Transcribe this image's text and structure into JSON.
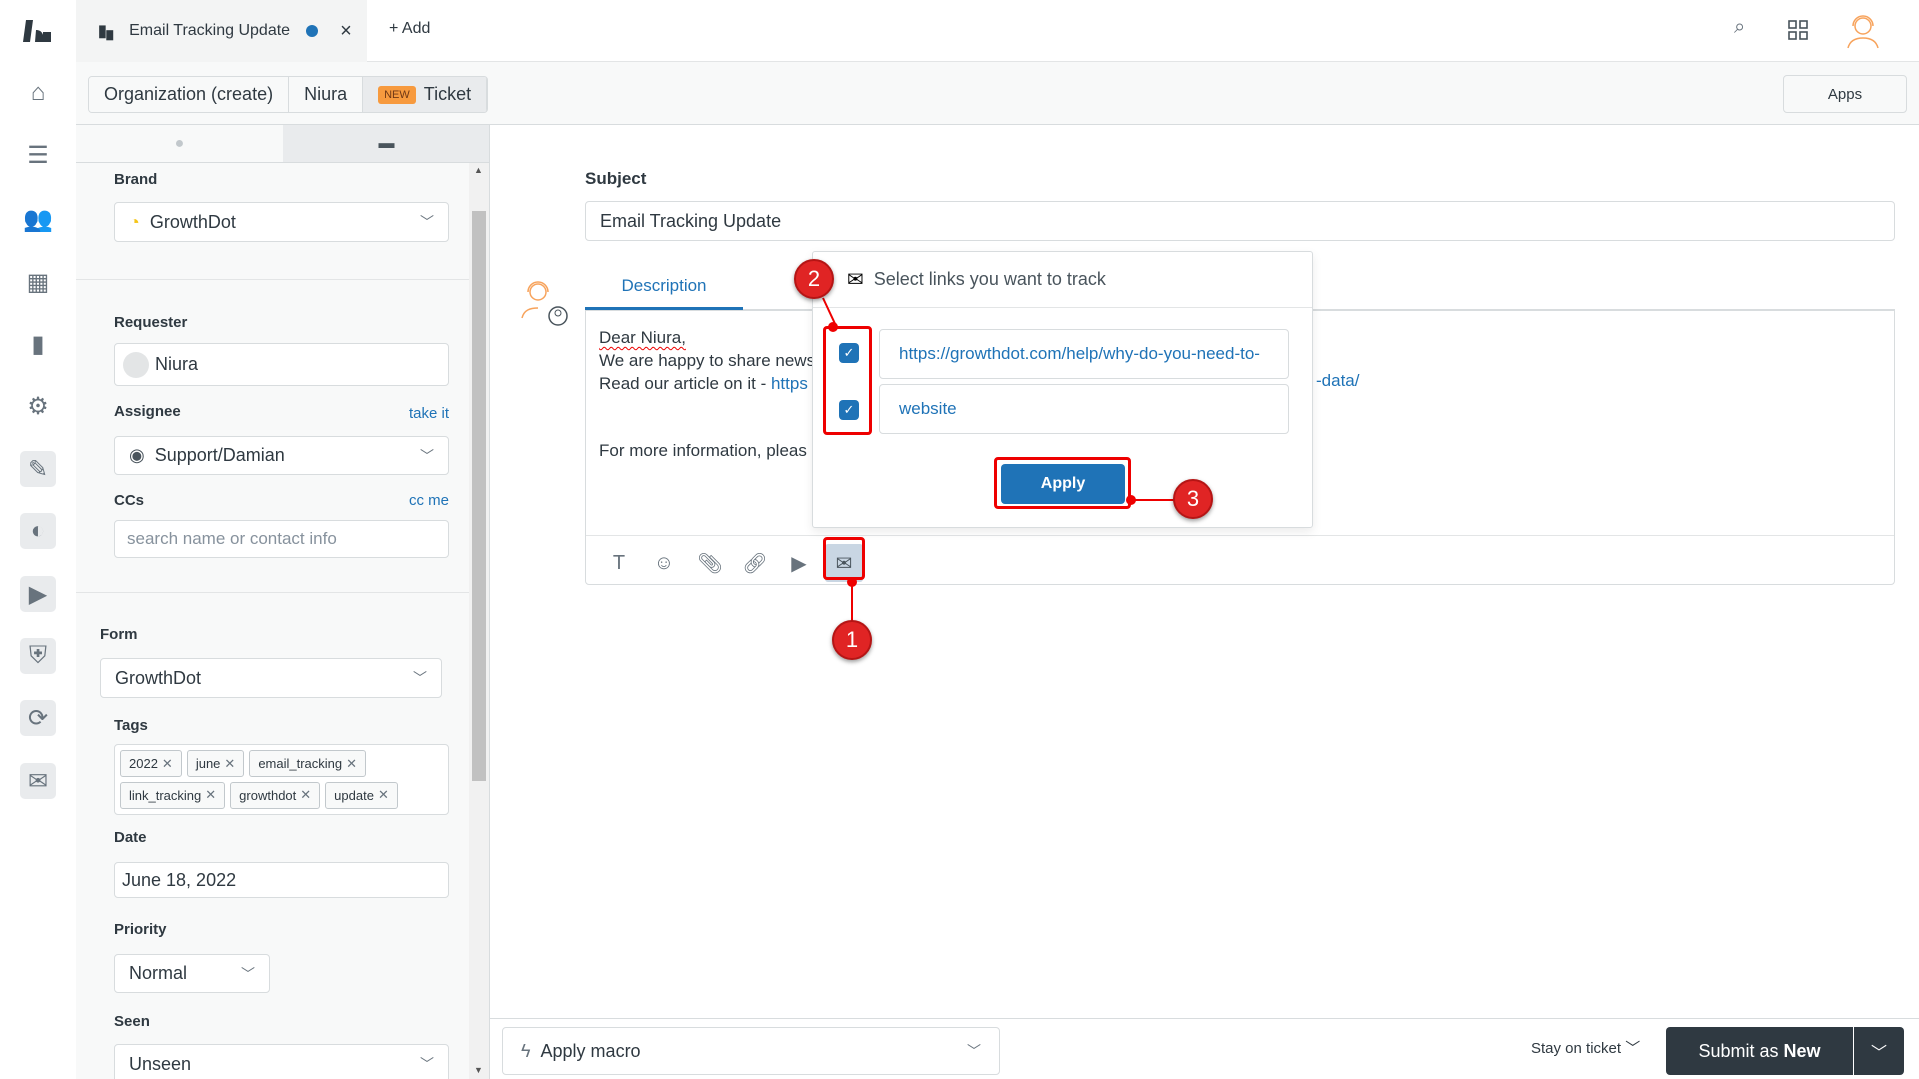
{
  "nav": {
    "items": [
      "logo-icon",
      "home-icon",
      "views-icon",
      "customers-icon",
      "organizations-icon",
      "reporting-icon",
      "admin-icon",
      "app1-icon",
      "app2-icon",
      "app3-icon",
      "app4-icon",
      "app5-icon",
      "email-tracking-icon"
    ]
  },
  "tabs": {
    "active": "Email Tracking Update",
    "add": "Add",
    "close": "×"
  },
  "breadcrumb": {
    "items": [
      "Organization (create)",
      "Niura"
    ],
    "badge": "NEW",
    "ticket": "Ticket"
  },
  "apps_label": "Apps",
  "sidebar": {
    "brand": {
      "label": "Brand",
      "value": "GrowthDot"
    },
    "requester": {
      "label": "Requester",
      "value": "Niura"
    },
    "assignee": {
      "label": "Assignee",
      "value": "Support/Damian",
      "link": "take it"
    },
    "ccs": {
      "label": "CCs",
      "link": "cc me",
      "placeholder": "search name or contact info"
    },
    "form": {
      "label": "Form",
      "value": "GrowthDot"
    },
    "tags": {
      "label": "Tags",
      "items": [
        "2022",
        "june",
        "email_tracking",
        "link_tracking",
        "growthdot",
        "update"
      ]
    },
    "date": {
      "label": "Date",
      "value": "June 18, 2022"
    },
    "priority": {
      "label": "Priority",
      "value": "Normal"
    },
    "seen": {
      "label": "Seen",
      "value": "Unseen"
    }
  },
  "main": {
    "subject_label": "Subject",
    "subject": "Email Tracking Update",
    "description_tab": "Description",
    "body": {
      "line1": "Dear Niura,",
      "line2": "We are happy to share news",
      "line3_prefix": "Read our article on it - ",
      "line3_link": "https",
      "line3_tail": "-data/",
      "line4": "For more information, pleas"
    }
  },
  "popup": {
    "title": "Select links you want to track",
    "links": [
      {
        "text": "https://growthdot.com/help/why-do-you-need-to-",
        "checked": true
      },
      {
        "text": "website",
        "checked": true
      }
    ],
    "apply": "Apply"
  },
  "annotations": [
    "1",
    "2",
    "3"
  ],
  "annotation_color": "#e00000",
  "footer": {
    "macro": "Apply macro",
    "stay": "Stay on ticket",
    "submit_prefix": "Submit as ",
    "submit_bold": "New"
  },
  "colors": {
    "accent": "#1f73b7",
    "dark": "#2f3941"
  }
}
